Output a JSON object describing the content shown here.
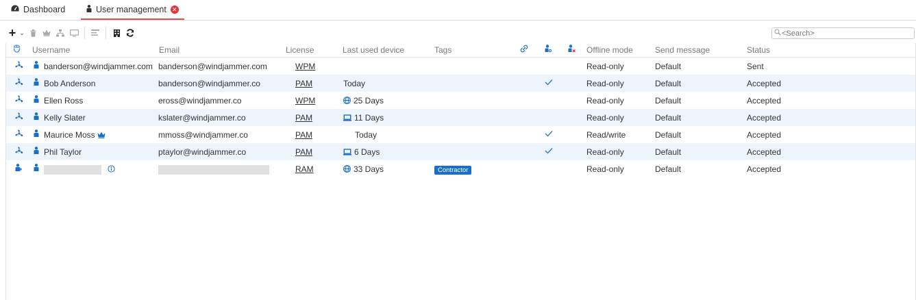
{
  "tabs": [
    {
      "label": "Dashboard",
      "icon": "dashboard-icon"
    },
    {
      "label": "User management",
      "icon": "person-icon",
      "active": true,
      "close_icon": "close-icon"
    }
  ],
  "toolbar": {
    "icons": [
      "plus-icon",
      "chevron-down-icon",
      "trash-icon",
      "crown-icon",
      "hierarchy-icon",
      "monitor-icon",
      "list-icon",
      "building-icon",
      "refresh-icon"
    ]
  },
  "search": {
    "placeholder": "<Search>"
  },
  "columns": {
    "username": "Username",
    "email": "Email",
    "license": "License",
    "last_used_device": "Last used device",
    "tags": "Tags",
    "offline_mode": "Offline mode",
    "send_message": "Send message",
    "status": "Status"
  },
  "rows": [
    {
      "username": "banderson@windjammer.com",
      "email": "banderson@windjammer.com",
      "license": "WPM",
      "device": "",
      "device_icon": "",
      "tags": "",
      "check": false,
      "offline_mode": "Read-only",
      "send_message": "Default",
      "status": "Sent"
    },
    {
      "username": "Bob Anderson",
      "email": "banderson@windjammer.co",
      "license": "PAM",
      "device": "Today",
      "device_icon": "",
      "tags": "",
      "check": true,
      "offline_mode": "Read-only",
      "send_message": "Default",
      "status": "Accepted"
    },
    {
      "username": "Ellen Ross",
      "email": "eross@windjammer.co",
      "license": "WPM",
      "device": "25 Days",
      "device_icon": "globe-icon",
      "tags": "",
      "check": false,
      "offline_mode": "Read-only",
      "send_message": "Default",
      "status": "Accepted"
    },
    {
      "username": "Kelly Slater",
      "email": "kslater@windjammer.co",
      "license": "PAM",
      "device": "11 Days",
      "device_icon": "laptop-icon",
      "tags": "",
      "check": false,
      "offline_mode": "Read-only",
      "send_message": "Default",
      "status": "Accepted"
    },
    {
      "username": "Maurice Moss",
      "email": "mmoss@windjammer.co",
      "license": "PAM",
      "device": "Today",
      "device_icon": "",
      "tags": "",
      "check": true,
      "offline_mode": "Read/write",
      "send_message": "Default",
      "status": "Accepted"
    },
    {
      "username": "Phil Taylor",
      "email": "ptaylor@windjammer.co",
      "license": "PAM",
      "device": "6 Days",
      "device_icon": "laptop-icon",
      "tags": "",
      "check": true,
      "offline_mode": "Read-only",
      "send_message": "Default",
      "status": "Accepted"
    },
    {
      "username": "",
      "email": "",
      "license": "RAM",
      "device": "33 Days",
      "device_icon": "globe-icon",
      "tags": "Contractor",
      "check": false,
      "offline_mode": "Read-only",
      "send_message": "Default",
      "status": "Accepted"
    }
  ],
  "colors": {
    "accent": "#1a6fc9",
    "tab_underline": "#d9534f",
    "close": "#e0353a",
    "row_alt": "#eef4fb"
  }
}
